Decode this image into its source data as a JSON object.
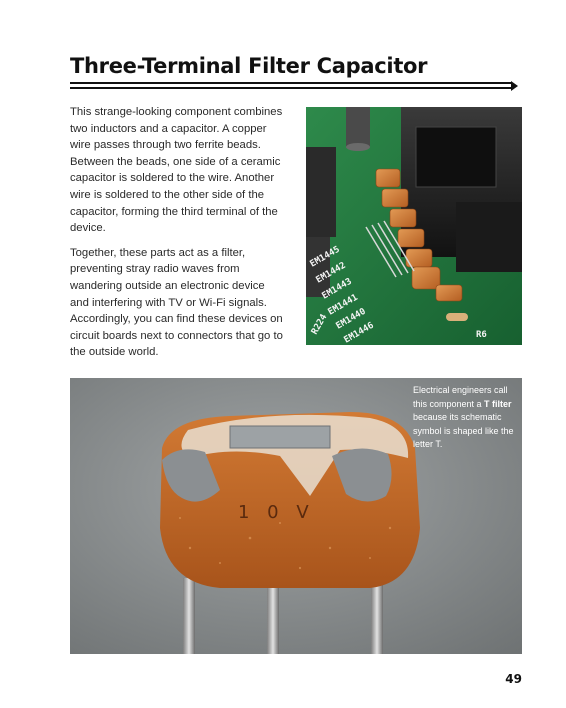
{
  "page": {
    "title": "Three-Terminal Filter Capacitor",
    "paragraph1": "This strange-looking component combines two inductors and a capacitor. A copper wire passes through two ferrite beads. Between the beads, one side of a ceramic capacitor is soldered to the wire. Another wire is soldered to the other side of the capacitor, forming the third terminal of the device.",
    "paragraph2": "Together, these parts act as a filter, preventing stray radio waves from wandering outside an electronic device and interfering with TV or Wi-Fi signals. Accordingly, you can find these devices on circuit boards next to connectors that go to the outside world.",
    "caption": {
      "before": "Electrical engineers call this component a ",
      "term": "T filter",
      "after": " because its schematic symbol is shaped like the letter T."
    },
    "board_labels": [
      "EM1445",
      "EM1442",
      "EM1443",
      "EM1441",
      "EM1440",
      "EM1446",
      "R224",
      "R6"
    ],
    "component_marking": "1 0 V",
    "page_number": "49"
  },
  "colors": {
    "accent": "#111111",
    "pcb_green": "#1f6b3a",
    "ceramic_orange": "#c8692a",
    "ferrite_gray": "#8a8d90",
    "background_gray": "#8f9394"
  }
}
